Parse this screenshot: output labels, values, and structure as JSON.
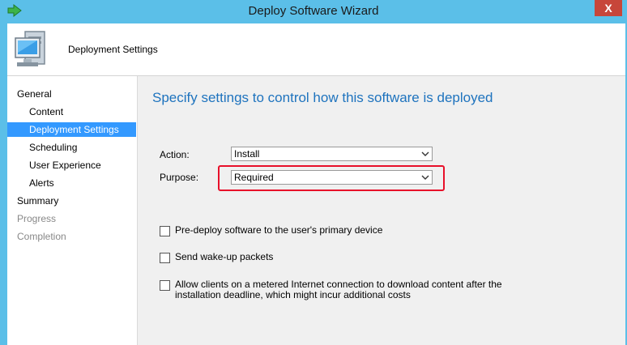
{
  "window": {
    "title": "Deploy Software Wizard",
    "close_label": "X",
    "accent": "#5bbfe8"
  },
  "header": {
    "title": "Deployment Settings",
    "icon": "computer-icon"
  },
  "nav": {
    "items": [
      {
        "label": "General",
        "state": "normal"
      },
      {
        "label": "Content",
        "state": "normal"
      },
      {
        "label": "Deployment Settings",
        "state": "active"
      },
      {
        "label": "Scheduling",
        "state": "normal"
      },
      {
        "label": "User Experience",
        "state": "normal"
      },
      {
        "label": "Alerts",
        "state": "normal"
      },
      {
        "label": "Summary",
        "state": "normal"
      },
      {
        "label": "Progress",
        "state": "disabled"
      },
      {
        "label": "Completion",
        "state": "disabled"
      }
    ],
    "active_color": "#3399ff"
  },
  "main": {
    "heading": "Specify settings to control how this software is deployed",
    "action": {
      "label": "Action:",
      "value": "Install"
    },
    "purpose": {
      "label": "Purpose:",
      "value": "Required"
    },
    "highlight_color": "#e8102a",
    "checkboxes": [
      {
        "label": "Pre-deploy software to the user's primary device",
        "checked": false
      },
      {
        "label": "Send wake-up packets",
        "checked": false
      },
      {
        "label_line1": "Allow clients on a metered Internet connection to download content after the",
        "label_line2": "installation deadline, which might incur additional costs",
        "checked": false
      }
    ]
  }
}
